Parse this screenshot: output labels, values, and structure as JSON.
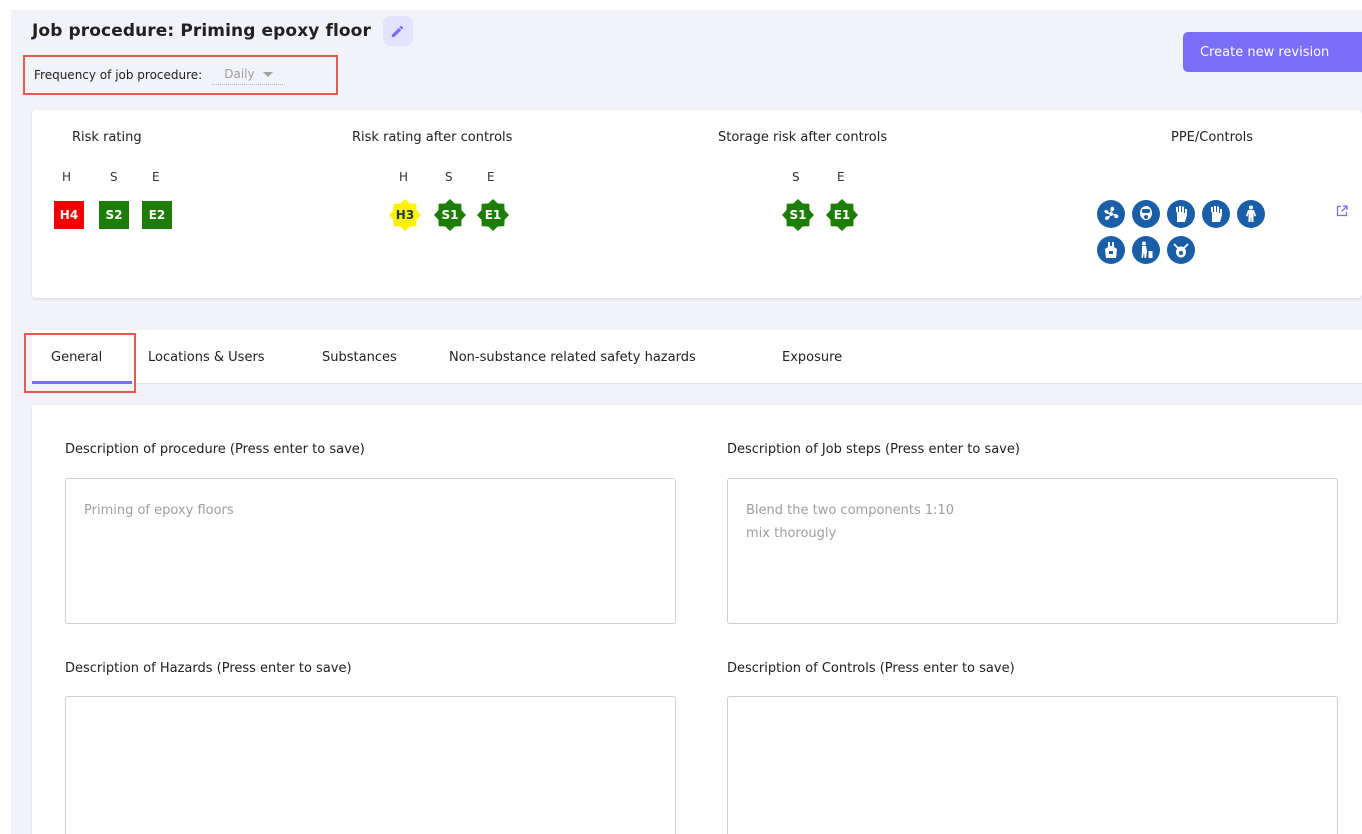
{
  "page": {
    "title": "Job procedure: Priming epoxy floor",
    "frequency_label": "Frequency of job procedure:",
    "frequency_value": "Daily",
    "create_revision": "Create new revision"
  },
  "risk_panel": {
    "risk_rating": {
      "heading": "Risk rating",
      "letters": [
        "H",
        "S",
        "E"
      ],
      "badges": [
        {
          "label": "H4",
          "color": "#f00000"
        },
        {
          "label": "S2",
          "color": "#1e7d07"
        },
        {
          "label": "E2",
          "color": "#1e7d07"
        }
      ]
    },
    "after_controls": {
      "heading": "Risk rating after controls",
      "letters": [
        "H",
        "S",
        "E"
      ],
      "badges": [
        {
          "label": "H3",
          "color": "#fff200"
        },
        {
          "label": "S1",
          "color": "#1e7d07"
        },
        {
          "label": "E1",
          "color": "#1e7d07"
        }
      ]
    },
    "storage": {
      "heading": "Storage risk after controls",
      "letters": [
        "S",
        "E"
      ],
      "badges": [
        {
          "label": "S1",
          "color": "#1e7d07"
        },
        {
          "label": "E1",
          "color": "#1e7d07"
        }
      ]
    },
    "ppe": {
      "heading": "PPE/Controls",
      "icons": [
        "ventilation-fan-icon",
        "full-face-respirator-icon",
        "protective-gloves-icon",
        "protective-gloves-icon",
        "protective-suit-icon",
        "apron-icon",
        "disposal-icon",
        "respirator-mask-icon"
      ],
      "icon_color": "#1a5ea8"
    }
  },
  "tabs": [
    "General",
    "Locations & Users",
    "Substances",
    "Non-substance related safety hazards",
    "Exposure"
  ],
  "active_tab": "General",
  "form": {
    "procedure": {
      "label": "Description of procedure (Press enter to save)",
      "value": "Priming of epoxy floors"
    },
    "job_steps": {
      "label": "Description of Job steps (Press enter to save)",
      "value": "Blend the two components 1:10\nmix thorougly"
    },
    "hazards": {
      "label": "Description of Hazards (Press enter to save)",
      "value": ""
    },
    "controls": {
      "label": "Description of Controls (Press enter to save)",
      "value": ""
    }
  }
}
